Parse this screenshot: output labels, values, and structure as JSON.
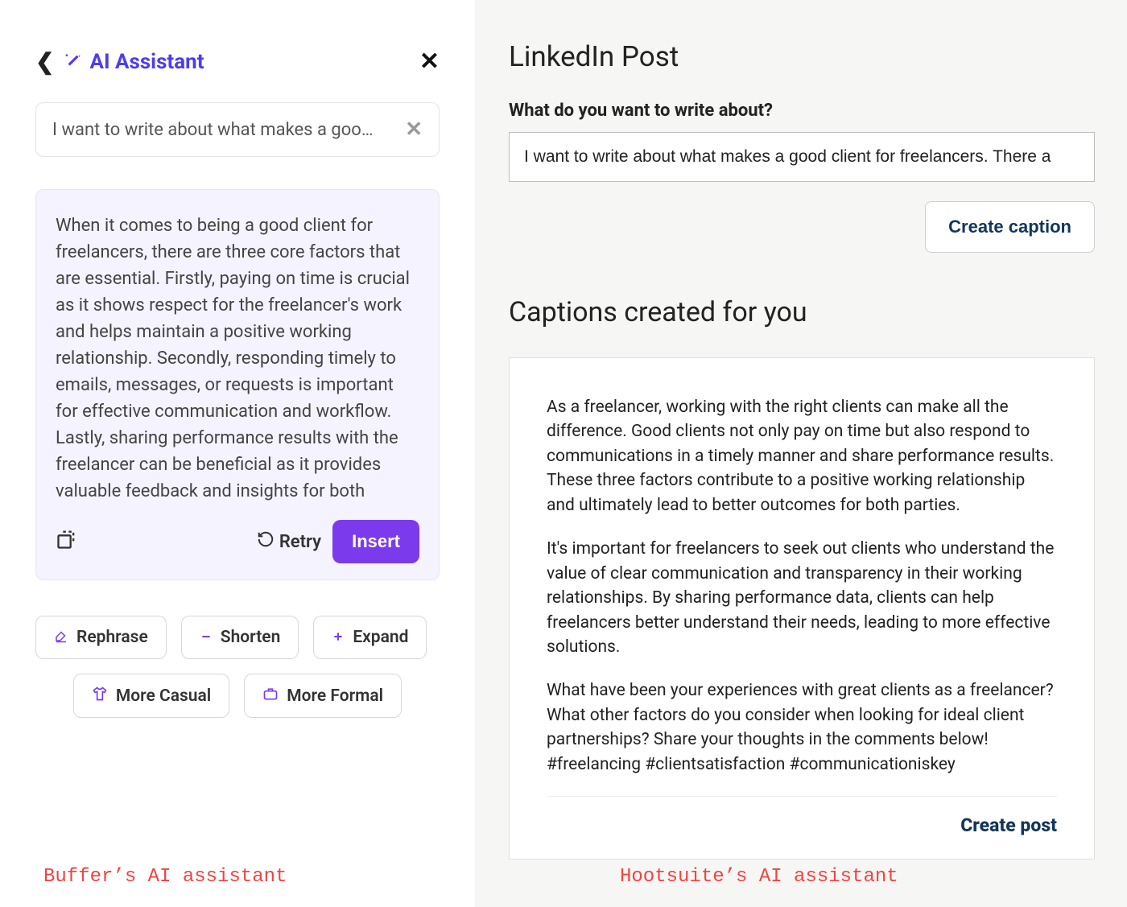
{
  "buffer": {
    "title": "AI Assistant",
    "prompt_truncated": "I want to write about what makes a goo…",
    "result": "When it comes to being a good client for freelancers, there are three core factors that are essential. Firstly, paying on time is crucial as it shows respect for the freelancer's work and helps maintain a positive working relationship. Secondly, responding timely to emails, messages, or requests is important for effective communication and workflow. Lastly, sharing performance results with the freelancer can be beneficial as it provides valuable feedback and insights for both parties. By adhering to these three factors",
    "retry_label": "Retry",
    "insert_label": "Insert",
    "chips": {
      "rephrase": "Rephrase",
      "shorten": "Shorten",
      "expand": "Expand",
      "casual": "More Casual",
      "formal": "More Formal"
    },
    "annotation": "Buffer’s AI assistant"
  },
  "hootsuite": {
    "title": "LinkedIn Post",
    "prompt_label": "What do you want to write about?",
    "input_value": "I want to write about what makes a good client for freelancers. There a",
    "create_caption_label": "Create caption",
    "captions_heading": "Captions created for you",
    "caption": {
      "p1": "As a freelancer, working with the right clients can make all the difference. Good clients not only pay on time but also respond to communications in a timely manner and share performance results. These three factors contribute to a positive working relationship and ultimately lead to better outcomes for both parties.",
      "p2": "It's important for freelancers to seek out clients who understand the value of clear communication and transparency in their working relationships. By sharing performance data, clients can help freelancers better understand their needs, leading to more effective solutions.",
      "p3": "What have been your experiences with great clients as a freelancer? What other factors do you consider when looking for ideal client partnerships? Share your thoughts in the comments below! #freelancing #clientsatisfaction #communicationiskey"
    },
    "create_post_label": "Create post",
    "annotation": "Hootsuite’s AI assistant"
  }
}
